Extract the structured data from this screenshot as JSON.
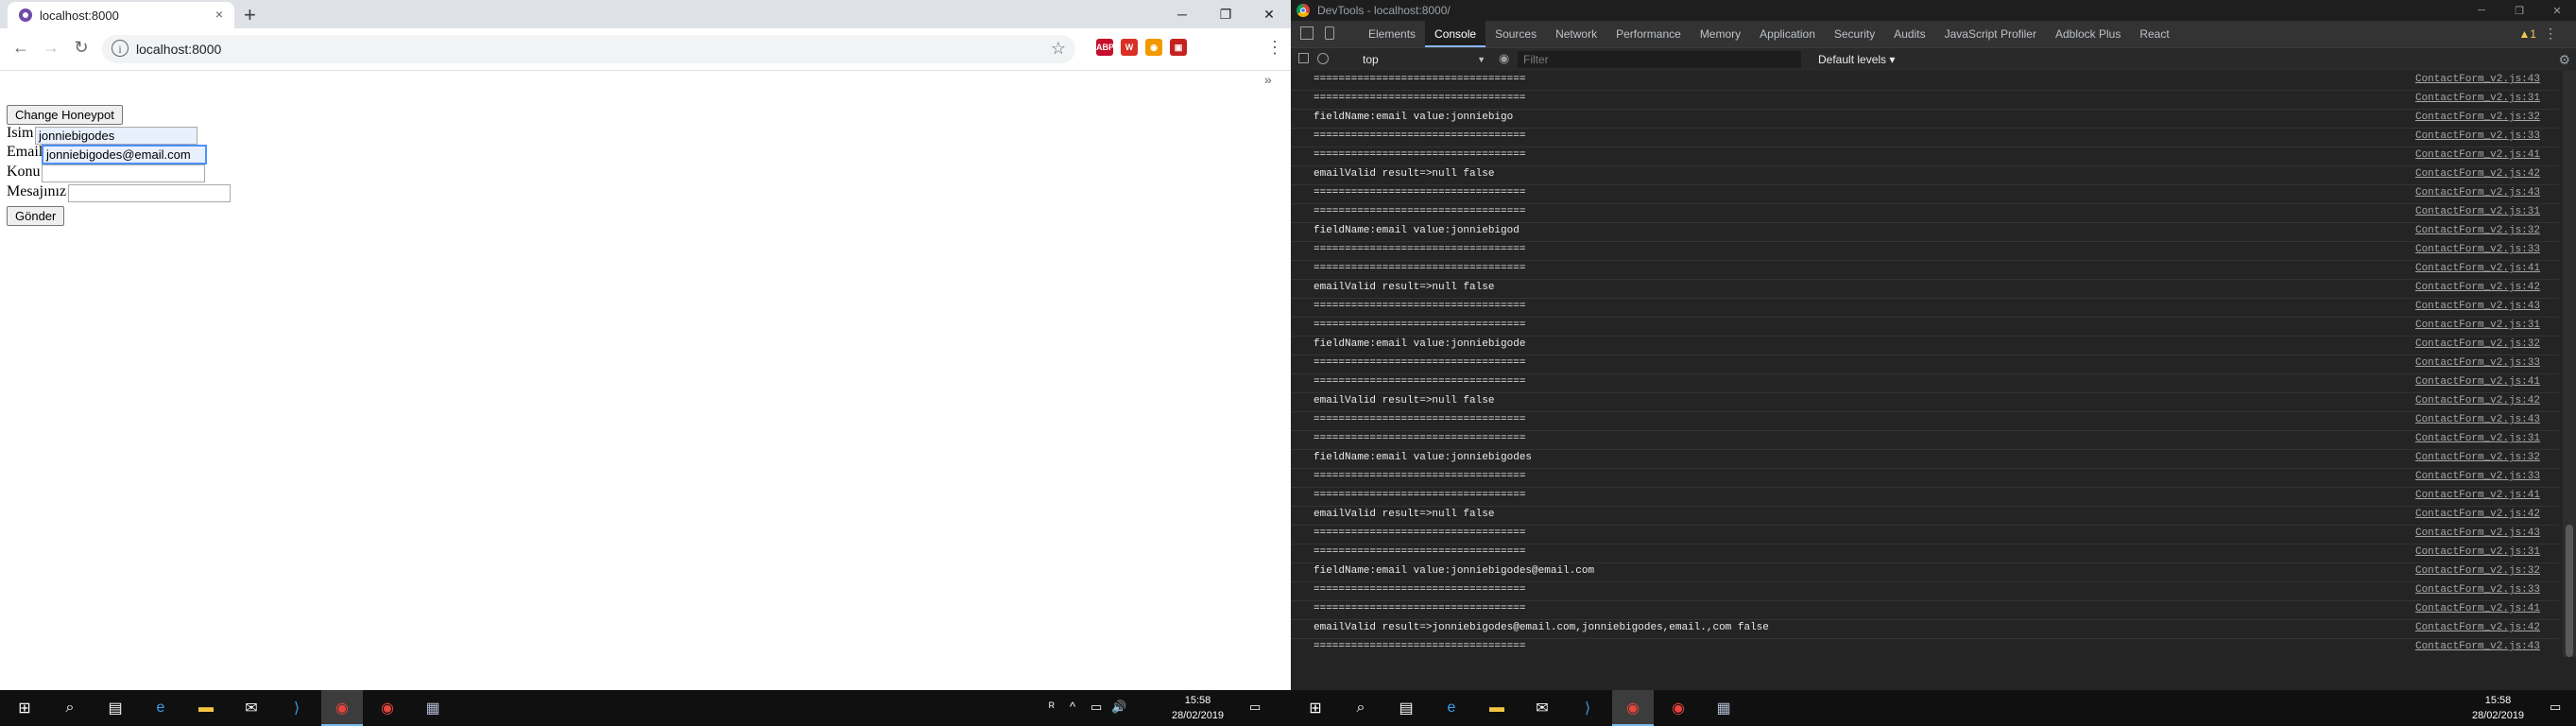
{
  "browser": {
    "tab_title": "localhost:8000",
    "tab_close": "×",
    "new_tab": "+",
    "url": "localhost:8000",
    "info_glyph": "i",
    "star_glyph": "☆",
    "menu_glyph": "⋮",
    "bookmarks_more": "»",
    "window_controls": {
      "minimize": "─",
      "maximize": "❐",
      "close": "✕"
    },
    "nav": {
      "back": "←",
      "forward": "→",
      "reload": "↻"
    },
    "extensions": [
      {
        "label": "ABP",
        "color": "#c70d2c"
      },
      {
        "label": "W",
        "color": "#d93025"
      },
      {
        "label": "◉",
        "color": "#f29900"
      },
      {
        "label": "▣",
        "color": "#c5221f"
      }
    ]
  },
  "page": {
    "honeypot_button": "Change Honeypot",
    "form": {
      "name_label": "Isim",
      "name_value": "jonniebigodes",
      "email_label": "Email",
      "email_value": "jonniebigodes@email.com",
      "subject_label": "Konu",
      "subject_value": "",
      "message_label": "Mesajınız",
      "message_value": "",
      "submit_label": "Gönder"
    }
  },
  "devtools": {
    "title": "DevTools - localhost:8000/",
    "window_controls": {
      "minimize": "─",
      "maximize": "❐",
      "close": "✕"
    },
    "tabs": [
      "Elements",
      "Console",
      "Sources",
      "Network",
      "Performance",
      "Memory",
      "Application",
      "Security",
      "Audits",
      "JavaScript Profiler",
      "Adblock Plus",
      "React"
    ],
    "active_tab": "Console",
    "warnings": "▲1",
    "more_glyph": "⋮",
    "context": "top",
    "context_caret": "▼",
    "filter_placeholder": "Filter",
    "levels": "Default levels ▾",
    "settings_glyph": "⚙",
    "prompt": "›",
    "console_rows": [
      {
        "msg": "==================================",
        "src": "ContactForm_v2.js:43"
      },
      {
        "msg": "==================================",
        "src": "ContactForm_v2.js:31"
      },
      {
        "msg": "fieldName:email value:jonniebigo",
        "src": "ContactForm_v2.js:32"
      },
      {
        "msg": "==================================",
        "src": "ContactForm_v2.js:33"
      },
      {
        "msg": "==================================",
        "src": "ContactForm_v2.js:41"
      },
      {
        "msg": "emailValid result=>null false",
        "src": "ContactForm_v2.js:42"
      },
      {
        "msg": "==================================",
        "src": "ContactForm_v2.js:43"
      },
      {
        "msg": "==================================",
        "src": "ContactForm_v2.js:31"
      },
      {
        "msg": "fieldName:email value:jonniebigod",
        "src": "ContactForm_v2.js:32"
      },
      {
        "msg": "==================================",
        "src": "ContactForm_v2.js:33"
      },
      {
        "msg": "==================================",
        "src": "ContactForm_v2.js:41"
      },
      {
        "msg": "emailValid result=>null false",
        "src": "ContactForm_v2.js:42"
      },
      {
        "msg": "==================================",
        "src": "ContactForm_v2.js:43"
      },
      {
        "msg": "==================================",
        "src": "ContactForm_v2.js:31"
      },
      {
        "msg": "fieldName:email value:jonniebigode",
        "src": "ContactForm_v2.js:32"
      },
      {
        "msg": "==================================",
        "src": "ContactForm_v2.js:33"
      },
      {
        "msg": "==================================",
        "src": "ContactForm_v2.js:41"
      },
      {
        "msg": "emailValid result=>null false",
        "src": "ContactForm_v2.js:42"
      },
      {
        "msg": "==================================",
        "src": "ContactForm_v2.js:43"
      },
      {
        "msg": "==================================",
        "src": "ContactForm_v2.js:31"
      },
      {
        "msg": "fieldName:email value:jonniebigodes",
        "src": "ContactForm_v2.js:32"
      },
      {
        "msg": "==================================",
        "src": "ContactForm_v2.js:33"
      },
      {
        "msg": "==================================",
        "src": "ContactForm_v2.js:41"
      },
      {
        "msg": "emailValid result=>null false",
        "src": "ContactForm_v2.js:42"
      },
      {
        "msg": "==================================",
        "src": "ContactForm_v2.js:43"
      },
      {
        "msg": "==================================",
        "src": "ContactForm_v2.js:31"
      },
      {
        "msg": "fieldName:email value:jonniebigodes@email.com",
        "src": "ContactForm_v2.js:32"
      },
      {
        "msg": "==================================",
        "src": "ContactForm_v2.js:33"
      },
      {
        "msg": "==================================",
        "src": "ContactForm_v2.js:41"
      },
      {
        "msg": "emailValid result=>jonniebigodes@email.com,jonniebigodes,email.,com false",
        "src": "ContactForm_v2.js:42"
      },
      {
        "msg": "==================================",
        "src": "ContactForm_v2.js:43"
      }
    ]
  },
  "taskbar": {
    "time": "15:58",
    "date": "28/02/2019",
    "tray_icons": [
      "ᴿ",
      "^",
      "▭",
      "🔊"
    ],
    "apps": [
      {
        "name": "start-icon",
        "glyph": "⊞",
        "color": "#ffffff"
      },
      {
        "name": "search-icon",
        "glyph": "⌕",
        "color": "#ffffff"
      },
      {
        "name": "task-view-icon",
        "glyph": "▤",
        "color": "#ffffff"
      },
      {
        "name": "edge-icon",
        "glyph": "e",
        "color": "#3aa0f0"
      },
      {
        "name": "file-explorer-icon",
        "glyph": "▬",
        "color": "#f4c542"
      },
      {
        "name": "mail-icon",
        "glyph": "✉",
        "color": "#ffffff"
      },
      {
        "name": "vscode-icon",
        "glyph": "⟩",
        "color": "#3c99d4"
      },
      {
        "name": "chrome-icon",
        "glyph": "◉",
        "color": "#e8453c"
      },
      {
        "name": "chrome-icon-2",
        "glyph": "◉",
        "color": "#e8453c"
      },
      {
        "name": "app-icon",
        "glyph": "▦",
        "color": "#b0b8d0"
      }
    ]
  }
}
